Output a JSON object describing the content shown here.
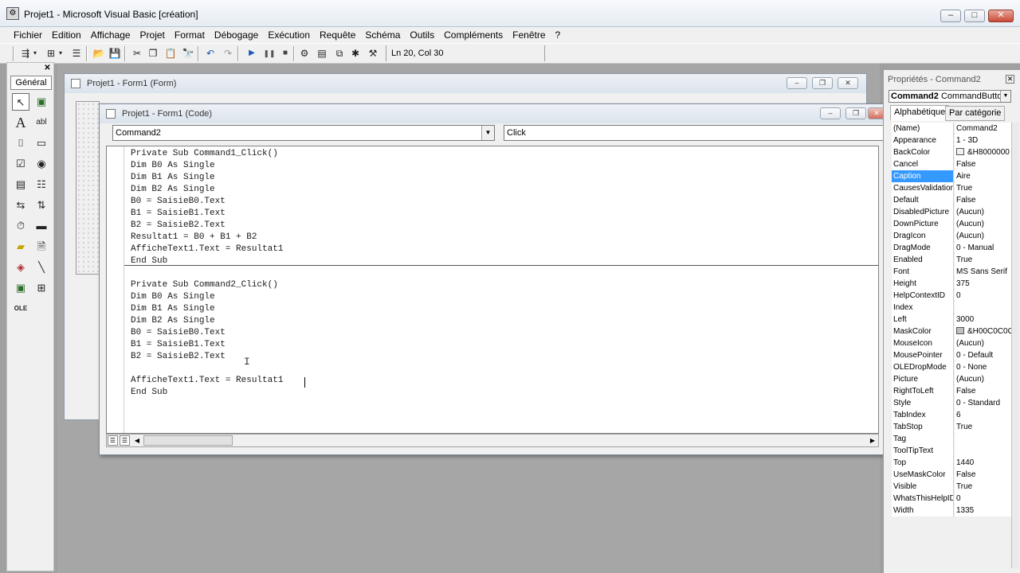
{
  "window": {
    "title": "Projet1 - Microsoft Visual Basic [création]"
  },
  "menu": [
    "Fichier",
    "Edition",
    "Affichage",
    "Projet",
    "Format",
    "Débogage",
    "Exécution",
    "Requête",
    "Schéma",
    "Outils",
    "Compléments",
    "Fenêtre",
    "?"
  ],
  "toolbar": {
    "position": "Ln 20, Col 30"
  },
  "toolbox": {
    "tab_label": "Général"
  },
  "form_window": {
    "title": "Projet1 - Form1 (Form)"
  },
  "code_window": {
    "title": "Projet1 - Form1 (Code)",
    "object": "Command2",
    "procedure": "Click",
    "lines": [
      "Private Sub Command1_Click()",
      "Dim B0 As Single",
      "Dim B1 As Single",
      "Dim B2 As Single",
      "B0 = SaisieB0.Text",
      "B1 = SaisieB1.Text",
      "B2 = SaisieB2.Text",
      "Resultat1 = B0 + B1 + B2",
      "AfficheText1.Text = Resultat1",
      "End Sub",
      "",
      "Private Sub Command2_Click()",
      "Dim B0 As Single",
      "Dim B1 As Single",
      "Dim B2 As Single",
      "B0 = SaisieB0.Text",
      "B1 = SaisieB1.Text",
      "B2 = SaisieB2.Text",
      "",
      "AfficheText1.Text = Resultat1",
      "End Sub"
    ]
  },
  "properties": {
    "title": "Propriétés - Command2",
    "object_name": "Command2",
    "object_type": "CommandButton",
    "tabs": [
      "Alphabétique",
      "Par catégorie"
    ],
    "rows": [
      {
        "k": "(Name)",
        "v": "Command2"
      },
      {
        "k": "Appearance",
        "v": "1 - 3D"
      },
      {
        "k": "BackColor",
        "v": "&H8000000"
      },
      {
        "k": "Cancel",
        "v": "False"
      },
      {
        "k": "Caption",
        "v": "Aire"
      },
      {
        "k": "CausesValidation",
        "v": "True"
      },
      {
        "k": "Default",
        "v": "False"
      },
      {
        "k": "DisabledPicture",
        "v": "(Aucun)"
      },
      {
        "k": "DownPicture",
        "v": "(Aucun)"
      },
      {
        "k": "DragIcon",
        "v": "(Aucun)"
      },
      {
        "k": "DragMode",
        "v": "0 - Manual"
      },
      {
        "k": "Enabled",
        "v": "True"
      },
      {
        "k": "Font",
        "v": "MS Sans Serif"
      },
      {
        "k": "Height",
        "v": "375"
      },
      {
        "k": "HelpContextID",
        "v": "0"
      },
      {
        "k": "Index",
        "v": ""
      },
      {
        "k": "Left",
        "v": "3000"
      },
      {
        "k": "MaskColor",
        "v": "&H00C0C0C"
      },
      {
        "k": "MouseIcon",
        "v": "(Aucun)"
      },
      {
        "k": "MousePointer",
        "v": "0 - Default"
      },
      {
        "k": "OLEDropMode",
        "v": "0 - None"
      },
      {
        "k": "Picture",
        "v": "(Aucun)"
      },
      {
        "k": "RightToLeft",
        "v": "False"
      },
      {
        "k": "Style",
        "v": "0 - Standard"
      },
      {
        "k": "TabIndex",
        "v": "6"
      },
      {
        "k": "TabStop",
        "v": "True"
      },
      {
        "k": "Tag",
        "v": ""
      },
      {
        "k": "ToolTipText",
        "v": ""
      },
      {
        "k": "Top",
        "v": "1440"
      },
      {
        "k": "UseMaskColor",
        "v": "False"
      },
      {
        "k": "Visible",
        "v": "True"
      },
      {
        "k": "WhatsThisHelpID",
        "v": "0"
      },
      {
        "k": "Width",
        "v": "1335"
      }
    ]
  }
}
